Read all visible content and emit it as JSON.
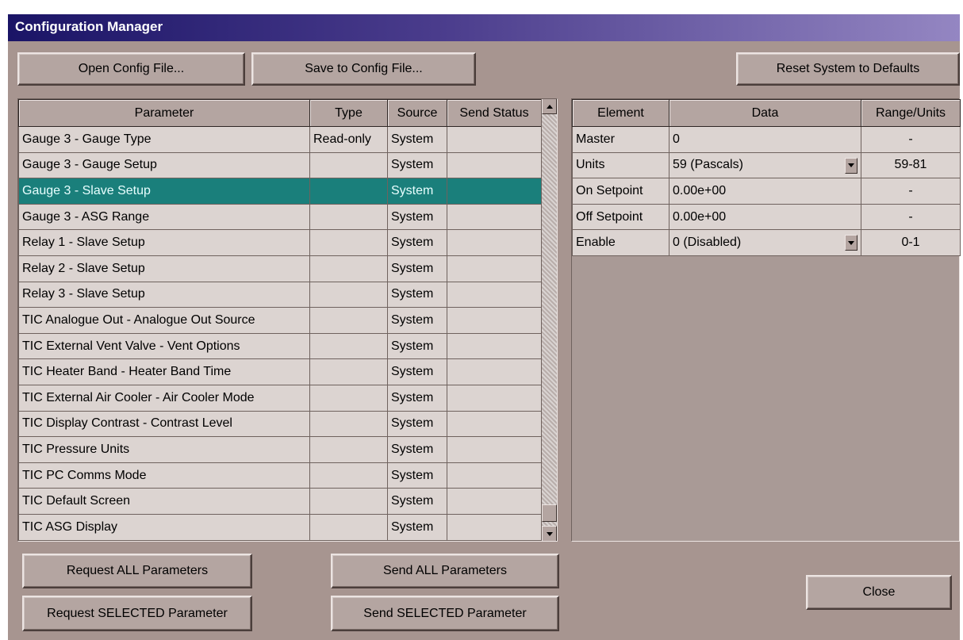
{
  "window": {
    "title": "Configuration Manager"
  },
  "toolbar": {
    "open_label": "Open Config File...",
    "save_label": "Save to Config File...",
    "reset_label": "Reset System to Defaults"
  },
  "param_table": {
    "columns": [
      "Parameter",
      "Type",
      "Source",
      "Send Status"
    ],
    "selected_row": 2,
    "rows": [
      {
        "parameter": "Gauge 3 - Gauge Type",
        "type": "Read-only",
        "source": "System",
        "status": ""
      },
      {
        "parameter": "Gauge 3 - Gauge Setup",
        "type": "",
        "source": "System",
        "status": ""
      },
      {
        "parameter": "Gauge 3 - Slave Setup",
        "type": "",
        "source": "System",
        "status": ""
      },
      {
        "parameter": "Gauge 3 - ASG Range",
        "type": "",
        "source": "System",
        "status": ""
      },
      {
        "parameter": "Relay 1 - Slave Setup",
        "type": "",
        "source": "System",
        "status": ""
      },
      {
        "parameter": "Relay 2 - Slave Setup",
        "type": "",
        "source": "System",
        "status": ""
      },
      {
        "parameter": "Relay 3 - Slave Setup",
        "type": "",
        "source": "System",
        "status": ""
      },
      {
        "parameter": "TIC Analogue Out - Analogue Out Source",
        "type": "",
        "source": "System",
        "status": ""
      },
      {
        "parameter": "TIC External Vent Valve - Vent Options",
        "type": "",
        "source": "System",
        "status": ""
      },
      {
        "parameter": "TIC Heater Band - Heater Band Time",
        "type": "",
        "source": "System",
        "status": ""
      },
      {
        "parameter": "TIC External Air Cooler - Air Cooler Mode",
        "type": "",
        "source": "System",
        "status": ""
      },
      {
        "parameter": "TIC Display Contrast - Contrast Level",
        "type": "",
        "source": "System",
        "status": ""
      },
      {
        "parameter": "TIC Pressure Units",
        "type": "",
        "source": "System",
        "status": ""
      },
      {
        "parameter": "TIC PC Comms Mode",
        "type": "",
        "source": "System",
        "status": ""
      },
      {
        "parameter": "TIC Default Screen",
        "type": "",
        "source": "System",
        "status": ""
      },
      {
        "parameter": "TIC ASG Display",
        "type": "",
        "source": "System",
        "status": ""
      }
    ]
  },
  "element_table": {
    "columns": [
      "Element",
      "Data",
      "Range/Units"
    ],
    "rows": [
      {
        "element": "Master",
        "data": "0",
        "range": "-",
        "dropdown": false
      },
      {
        "element": "Units",
        "data": "59 (Pascals)",
        "range": "59-81",
        "dropdown": true
      },
      {
        "element": "On Setpoint",
        "data": "0.00e+00",
        "range": "-",
        "dropdown": false
      },
      {
        "element": "Off Setpoint",
        "data": "0.00e+00",
        "range": "-",
        "dropdown": false
      },
      {
        "element": "Enable",
        "data": "0 (Disabled)",
        "range": "0-1",
        "dropdown": true
      }
    ]
  },
  "bottom": {
    "request_all_label": "Request ALL Parameters",
    "send_all_label": "Send ALL Parameters",
    "request_selected_label": "Request SELECTED Parameter",
    "send_selected_label": "Send SELECTED Parameter",
    "close_label": "Close"
  },
  "icons": {
    "scroll_up": "triangle-up-icon",
    "scroll_down": "triangle-down-icon",
    "dropdown": "triangle-down-icon"
  },
  "colors": {
    "window_bg": "#a79590",
    "titlebar_start": "#1a1466",
    "titlebar_end": "#9486c2",
    "selected_row": "#1a7f7b"
  }
}
